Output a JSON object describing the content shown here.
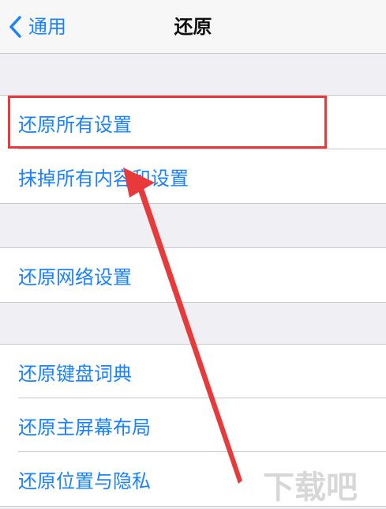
{
  "navbar": {
    "back_label": "通用",
    "title": "还原"
  },
  "groups": [
    {
      "items": [
        "还原所有设置",
        "抹掉所有内容和设置"
      ]
    },
    {
      "items": [
        "还原网络设置"
      ]
    },
    {
      "items": [
        "还原键盘词典",
        "还原主屏幕布局",
        "还原位置与隐私"
      ]
    }
  ],
  "colors": {
    "accent": "#1a82fb",
    "annotation": "#e83a3a",
    "background": "#efeff4"
  },
  "watermark": "下载吧"
}
